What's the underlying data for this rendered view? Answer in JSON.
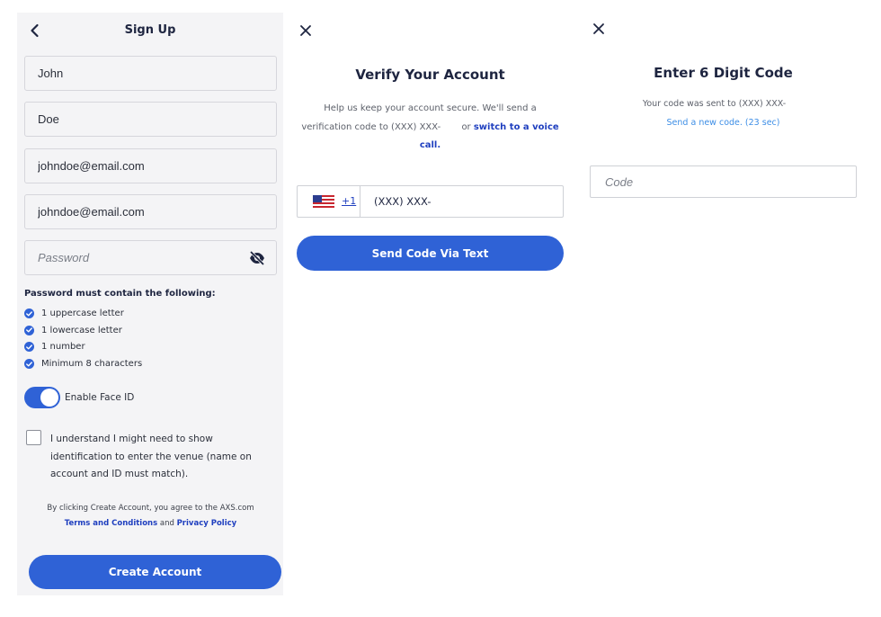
{
  "signup": {
    "title": "Sign Up",
    "fields": {
      "first_name": "John",
      "last_name": "Doe",
      "email": "johndoe@email.com",
      "confirm_email": "johndoe@email.com",
      "password_placeholder": "Password"
    },
    "password_requirements": {
      "heading": "Password must contain the following:",
      "items": [
        "1 uppercase letter",
        "1 lowercase letter",
        "1 number",
        "Minimum 8 characters"
      ]
    },
    "face_id": {
      "label": "Enable Face ID",
      "enabled": true
    },
    "id_consent": {
      "label": "I understand I might need to show identification to enter the venue (name on account and ID must match).",
      "checked": false
    },
    "legal": {
      "prefix": "By clicking Create Account, you agree to the AXS.com",
      "terms_link": "Terms and Conditions",
      "and": "and",
      "privacy_link": "Privacy Policy"
    },
    "create_button": "Create Account"
  },
  "verify": {
    "title": "Verify Your Account",
    "desc_part1": "Help us keep your account secure. We'll send a verification code to (XXX) XXX-",
    "desc_or": "or",
    "switch_link": "switch to a voice call.",
    "country_code": "+1",
    "phone_value": "(XXX) XXX-",
    "send_button": "Send Code Via Text"
  },
  "code_entry": {
    "title": "Enter 6 Digit Code",
    "sent_text": "Your code was sent to (XXX) XXX-",
    "resend_text": "Send a new code. (23 sec)",
    "code_placeholder": "Code"
  },
  "colors": {
    "primary": "#2f62d6",
    "link": "#1f3fbf",
    "title": "#1e2540",
    "panel_bg": "#f4f4f6"
  }
}
